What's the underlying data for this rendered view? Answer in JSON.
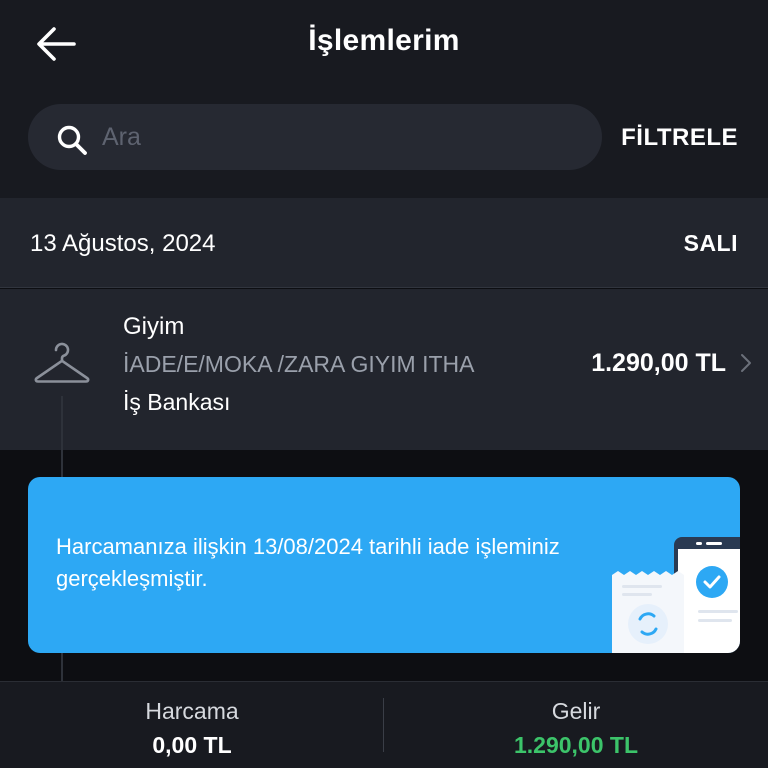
{
  "header": {
    "title": "İşlemlerim",
    "back_icon": "arrow-left-icon"
  },
  "search": {
    "placeholder": "Ara",
    "value": "",
    "icon": "search-icon"
  },
  "filter_label": "FİLTRELE",
  "date_group": {
    "date": "13 Ağustos, 2024",
    "day": "SALI"
  },
  "transaction": {
    "icon": "hanger-icon",
    "category": "Giyim",
    "description": "İADE/E/MOKA /ZARA GIYIM ITHA",
    "bank": "İş Bankası",
    "amount": "1.290,00 TL"
  },
  "banner": {
    "message": "Harcamanıza ilişkin 13/08/2024 tarihli iade işleminiz gerçekleşmiştir.",
    "background": "#2da8f4"
  },
  "summary": {
    "spend_label": "Harcama",
    "spend_value": "0,00 TL",
    "income_label": "Gelir",
    "income_value": "1.290,00 TL",
    "income_color": "#3cc46a"
  }
}
